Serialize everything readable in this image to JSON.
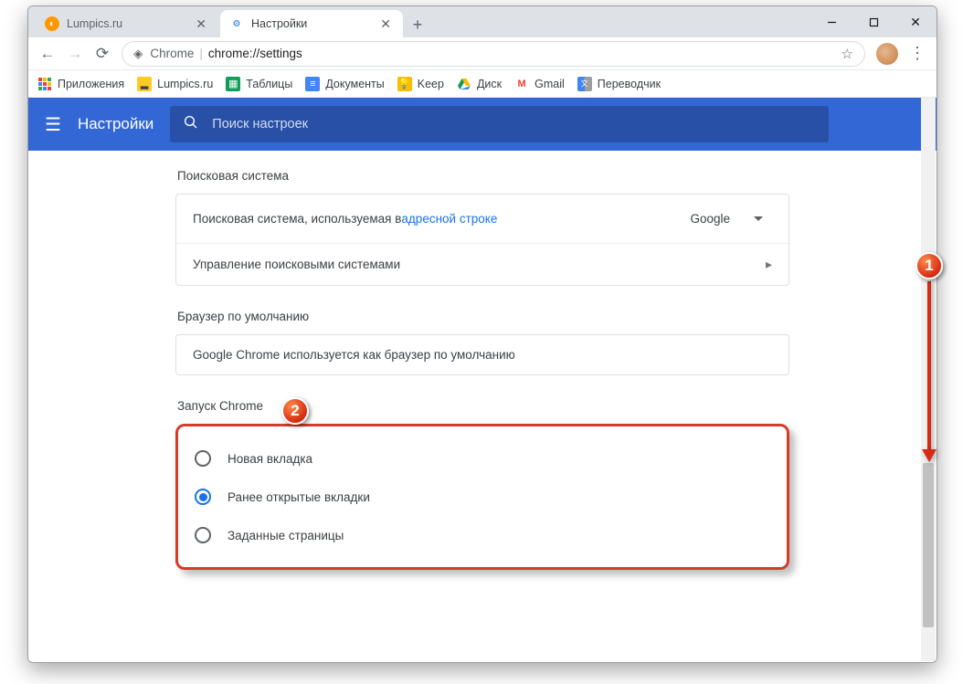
{
  "window": {
    "tabs": {
      "tab1_title": "Lumpics.ru",
      "tab2_title": "Настройки"
    },
    "new_tab_plus": "+"
  },
  "omnibox": {
    "chrome_label": "Chrome",
    "url_path": "chrome://settings"
  },
  "bookmarks": {
    "apps": "Приложения",
    "lumpics": "Lumpics.ru",
    "sheets": "Таблицы",
    "docs": "Документы",
    "keep": "Keep",
    "drive": "Диск",
    "gmail": "Gmail",
    "translate": "Переводчик"
  },
  "settings": {
    "header_title": "Настройки",
    "search_placeholder": "Поиск настроек",
    "search_section": {
      "title": "Поисковая система",
      "row1_prefix": "Поисковая система, используемая в ",
      "row1_link": "адресной строке",
      "selected_engine": "Google",
      "row2_label": "Управление поисковыми системами"
    },
    "default_browser_section": {
      "title": "Браузер по умолчанию",
      "row1_text": "Google Chrome используется как браузер по умолчанию"
    },
    "startup_section": {
      "title": "Запуск Chrome",
      "options": {
        "opt1": "Новая вкладка",
        "opt2": "Ранее открытые вкладки",
        "opt3": "Заданные страницы"
      },
      "selected_index": 1
    }
  },
  "annotations": {
    "marker1": "1",
    "marker2": "2"
  }
}
